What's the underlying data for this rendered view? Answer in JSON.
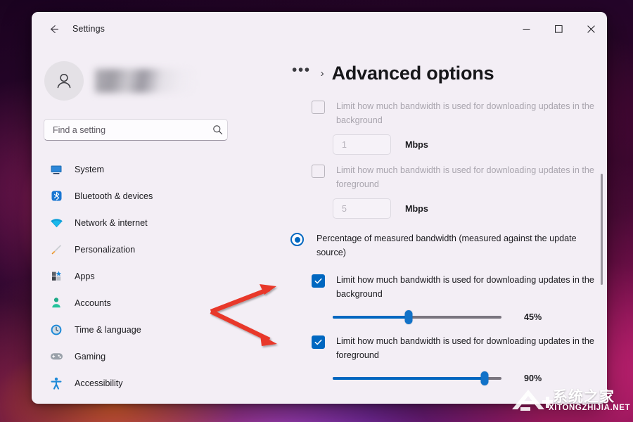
{
  "desktop": {
    "wallpaper_name": "windows-bloom-dark-wallpaper"
  },
  "window": {
    "title": "Settings",
    "back_icon": "back-arrow-icon",
    "controls": {
      "minimize": "—",
      "maximize": "□",
      "close": "✕"
    }
  },
  "sidebar": {
    "account": {
      "avatar_icon": "user-avatar-icon",
      "name_redacted": ""
    },
    "search": {
      "placeholder": "Find a setting",
      "value": "",
      "icon": "search-icon"
    },
    "items": [
      {
        "label": "System",
        "icon": "monitor-icon"
      },
      {
        "label": "Bluetooth & devices",
        "icon": "bluetooth-icon"
      },
      {
        "label": "Network & internet",
        "icon": "wifi-icon"
      },
      {
        "label": "Personalization",
        "icon": "paintbrush-icon"
      },
      {
        "label": "Apps",
        "icon": "apps-grid-icon"
      },
      {
        "label": "Accounts",
        "icon": "person-icon"
      },
      {
        "label": "Time & language",
        "icon": "clock-icon"
      },
      {
        "label": "Gaming",
        "icon": "gamepad-icon"
      },
      {
        "label": "Accessibility",
        "icon": "accessibility-icon"
      }
    ]
  },
  "main": {
    "breadcrumb": {
      "overflow": "•••",
      "separator": "›"
    },
    "page_title": "Advanced options",
    "absolute_section": {
      "background_checkbox": {
        "label": "Limit how much bandwidth is used for downloading updates in the background",
        "checked": false,
        "enabled": false
      },
      "background_value": {
        "value": "1",
        "unit": "Mbps",
        "enabled": false
      },
      "foreground_checkbox": {
        "label": "Limit how much bandwidth is used for downloading updates in the foreground",
        "checked": false,
        "enabled": false
      },
      "foreground_value": {
        "value": "5",
        "unit": "Mbps",
        "enabled": false
      }
    },
    "percentage_radio": {
      "label": "Percentage of measured bandwidth (measured against the update source)",
      "selected": true
    },
    "percentage_section": {
      "background_checkbox": {
        "label": "Limit how much bandwidth is used for downloading updates in the background",
        "checked": true
      },
      "background_slider": {
        "value": 45,
        "display": "45%",
        "min": 0,
        "max": 100
      },
      "foreground_checkbox": {
        "label": "Limit how much bandwidth is used for downloading updates in the foreground",
        "checked": true
      },
      "foreground_slider": {
        "value": 90,
        "display": "90%",
        "min": 0,
        "max": 100
      }
    }
  },
  "annotations": {
    "arrow_color": "#e8392b",
    "arrows": [
      {
        "name": "arrow-to-background-checkbox"
      },
      {
        "name": "arrow-to-foreground-checkbox"
      }
    ]
  },
  "watermark": {
    "text_cn": "系统之家",
    "text_url": "XITONGZHIJIA.NET"
  },
  "colors": {
    "accent": "#0067c0",
    "window_bg": "#f3eef5",
    "text": "#1b1b1f",
    "disabled_text": "#a9a5ae"
  }
}
